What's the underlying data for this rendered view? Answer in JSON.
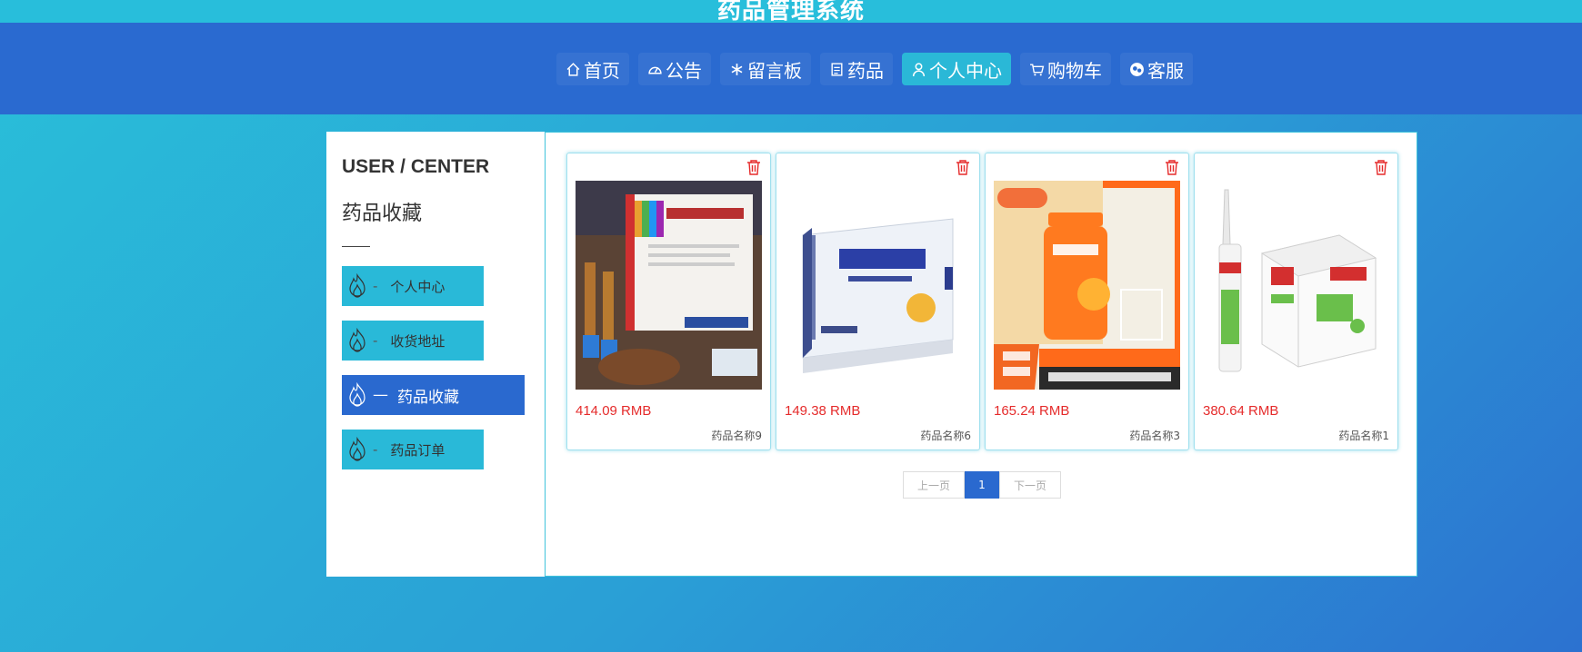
{
  "header": {
    "title": "药品管理系统"
  },
  "nav": [
    {
      "label": "首页",
      "icon": "home-icon"
    },
    {
      "label": "公告",
      "icon": "dashboard-icon"
    },
    {
      "label": "留言板",
      "icon": "snowflake-icon"
    },
    {
      "label": "药品",
      "icon": "document-icon"
    },
    {
      "label": "个人中心",
      "icon": "user-icon",
      "active": true
    },
    {
      "label": "购物车",
      "icon": "cart-icon"
    },
    {
      "label": "客服",
      "icon": "chat-icon"
    }
  ],
  "sidebar": {
    "title": "USER / CENTER",
    "subtitle": "药品收藏",
    "items": [
      {
        "label": "个人中心",
        "dash": "-"
      },
      {
        "label": "收货地址",
        "dash": "-"
      },
      {
        "label": "药品收藏",
        "dash": "—",
        "active": true
      },
      {
        "label": "药品订单",
        "dash": "-"
      }
    ]
  },
  "products": [
    {
      "price": "414.09 RMB",
      "name": "药品名称9"
    },
    {
      "price": "149.38 RMB",
      "name": "药品名称6"
    },
    {
      "price": "165.24 RMB",
      "name": "药品名称3"
    },
    {
      "price": "380.64 RMB",
      "name": "药品名称1"
    }
  ],
  "pagination": {
    "prev": "上一页",
    "current": "1",
    "next": "下一页"
  },
  "colors": {
    "accent": "#2ab8d7",
    "primary": "#2a69cf",
    "price": "#e52b2b"
  }
}
